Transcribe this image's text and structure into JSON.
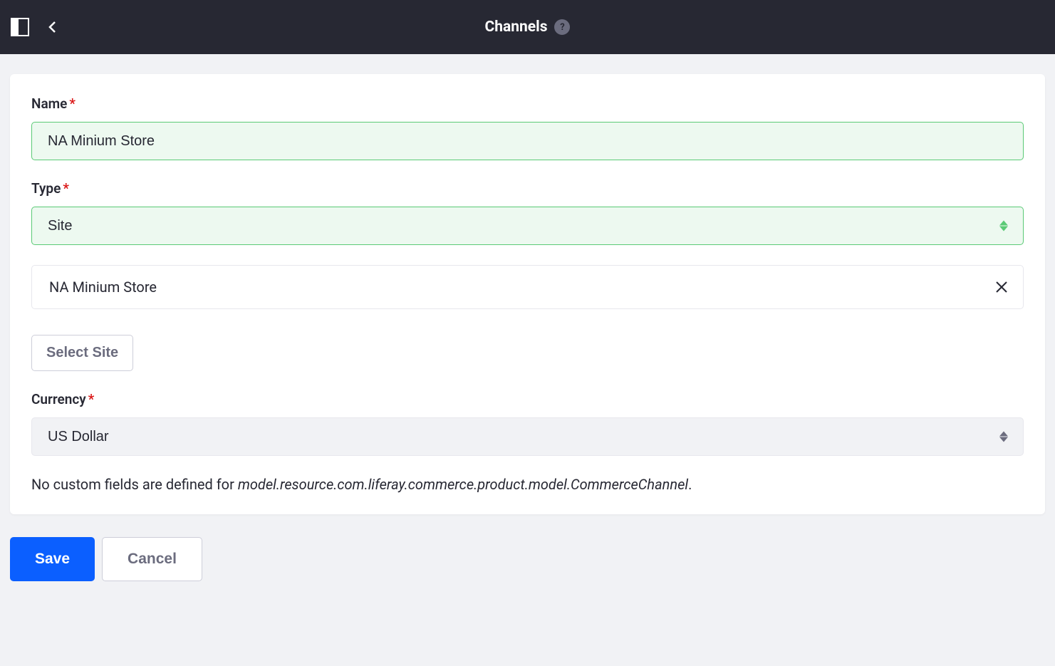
{
  "header": {
    "title": "Channels",
    "help_tooltip": "?"
  },
  "form": {
    "name": {
      "label": "Name",
      "value": "NA Minium Store"
    },
    "type": {
      "label": "Type",
      "value": "Site"
    },
    "selected_site": {
      "value": "NA Minium Store"
    },
    "select_site_button": "Select Site",
    "currency": {
      "label": "Currency",
      "value": "US Dollar"
    },
    "custom_fields_text": "No custom fields are defined for ",
    "custom_fields_model": "model.resource.com.liferay.commerce.product.model.CommerceChannel",
    "custom_fields_suffix": "."
  },
  "buttons": {
    "save": "Save",
    "cancel": "Cancel"
  }
}
